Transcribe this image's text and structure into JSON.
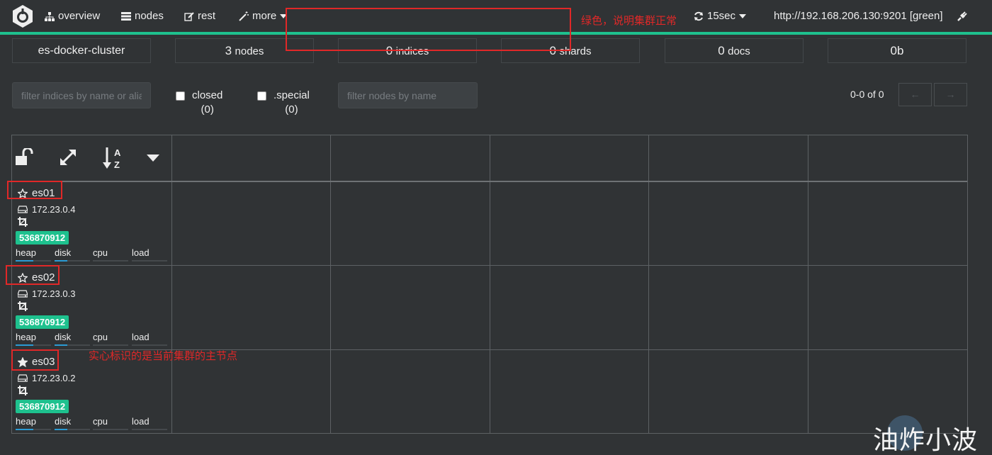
{
  "nav": {
    "overview": "overview",
    "nodes": "nodes",
    "rest": "rest",
    "more": "more",
    "refresh": "15sec",
    "url": "http://192.168.206.130:9201 [green]"
  },
  "stats": {
    "cluster_name": "es-docker-cluster",
    "nodes_num": "3",
    "nodes_unit": "nodes",
    "indices_num": "0",
    "indices_unit": "indices",
    "shards_num": "0",
    "shards_unit": "shards",
    "docs_num": "0",
    "docs_unit": "docs",
    "size": "0b"
  },
  "filters": {
    "indices_placeholder": "filter indices by name or aliases",
    "closed_label": "closed",
    "closed_count": "(0)",
    "special_label": ".special",
    "special_count": "(0)",
    "nodes_placeholder": "filter nodes by name",
    "pager_text": "0-0 of 0",
    "prev": "←",
    "next": "→"
  },
  "nodes": [
    {
      "name": "es01",
      "ip": "172.23.0.4",
      "heap_badge": "536870912",
      "master": false,
      "heap": "heap",
      "disk": "disk",
      "cpu": "cpu",
      "load": "load"
    },
    {
      "name": "es02",
      "ip": "172.23.0.3",
      "heap_badge": "536870912",
      "master": false,
      "heap": "heap",
      "disk": "disk",
      "cpu": "cpu",
      "load": "load"
    },
    {
      "name": "es03",
      "ip": "172.23.0.2",
      "heap_badge": "536870912",
      "master": true,
      "heap": "heap",
      "disk": "disk",
      "cpu": "cpu",
      "load": "load"
    }
  ],
  "metrics_fill": {
    "heap": 0.5,
    "disk": 0.35,
    "cpu": 0,
    "load": 0
  },
  "annotations": {
    "green_note": "绿色，说明集群正常",
    "master_note": "实心标识的是当前集群的主节点",
    "watermark": "油炸小波"
  },
  "colors": {
    "accent": "#1ec18e",
    "annotation": "#e02828",
    "background": "#303335"
  }
}
